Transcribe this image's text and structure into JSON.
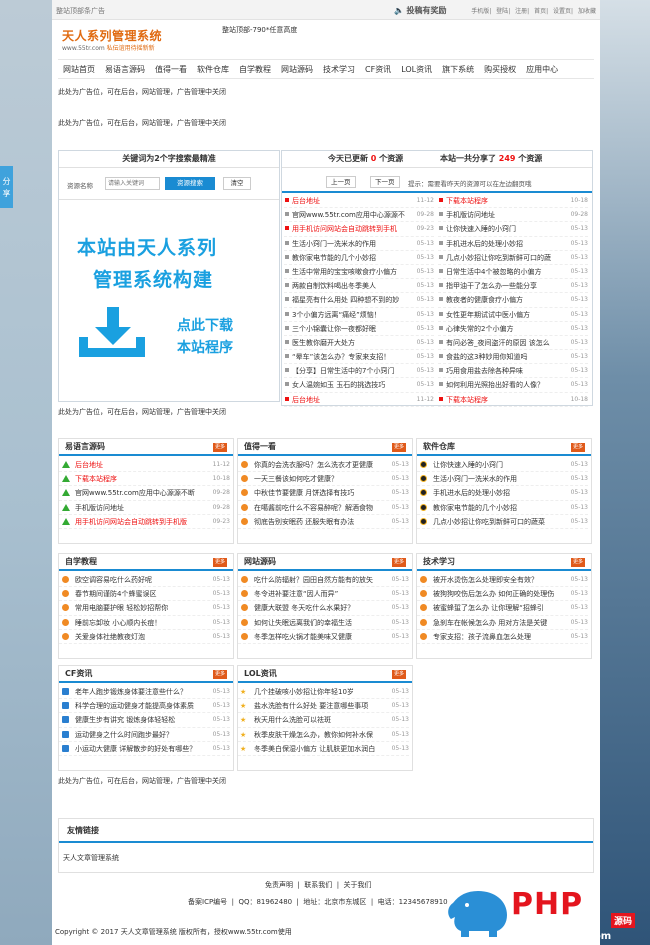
{
  "top": {
    "ad": "整站顶部条广告",
    "publish": "投稿有奖励",
    "links": [
      "手机版",
      "登陆",
      "注册",
      "首页",
      "设置页",
      "加收藏"
    ]
  },
  "logo": {
    "title": "天人系列管理系统",
    "url": "www.55tr.com",
    "slogan": "私伝谊用待摇新新"
  },
  "topad": "整站顶部-790*任意高度",
  "nav": [
    "网站首页",
    "易语言源码",
    "值得一看",
    "软件仓库",
    "自学教程",
    "网站源码",
    "技术学习",
    "CF资讯",
    "LOL资讯",
    "旗下系统",
    "购买授权",
    "应用中心"
  ],
  "ad_text": "此处为广告位，可在后台，网站管理，广告管理中关闭",
  "search": {
    "title": "关键词为2个字搜索最精准",
    "label": "资源名称",
    "placeholder": "请输入关键词",
    "search_btn": "资源搜索",
    "clear_btn": "清空"
  },
  "banner": {
    "line1": "本站由天人系列",
    "line2": "管理系统构建",
    "cta1": "点此下载",
    "cta2": "本站程序"
  },
  "today": {
    "prefix": "今天已更新",
    "count": "0",
    "suffix": "个资源"
  },
  "total": {
    "prefix": "本站一共分享了",
    "count": "249",
    "suffix": "个资源"
  },
  "pager": {
    "prev": "上一页",
    "next": "下一页",
    "hint": "提示：需要看昨天的资源可以在左边翻页哦"
  },
  "list_left": [
    {
      "t": "后台地址",
      "d": "11-12",
      "red": true
    },
    {
      "t": "官网www.55tr.com应用中心源源不",
      "d": "09-28"
    },
    {
      "t": "用手机访问网站会自动跳转到手机",
      "d": "09-23",
      "red": true
    },
    {
      "t": "生活小窍门一洗米水的作用",
      "d": "05-13"
    },
    {
      "t": "教你家电节能的几个小妙招",
      "d": "05-13"
    },
    {
      "t": "生活中常用的宝宝咳嗽食疗小偏方",
      "d": "05-13"
    },
    {
      "t": "两款自制饮料喝出冬季美人",
      "d": "05-13"
    },
    {
      "t": "福星亮有什么用处 四种想不到的妙",
      "d": "05-13"
    },
    {
      "t": "3个小偏方远离“痛经”烦恼！",
      "d": "05-13"
    },
    {
      "t": "三个小锦囊让你一夜都好眠",
      "d": "05-13"
    },
    {
      "t": "医生教你磨开大处方",
      "d": "05-13"
    },
    {
      "t": "“晕车”该怎么办？专家来支招！",
      "d": "05-13"
    },
    {
      "t": "【分享】日常生活中的7个小窍门",
      "d": "05-13"
    },
    {
      "t": "女人温婉如玉 玉石的挑选技巧",
      "d": "05-13"
    },
    {
      "t": "后台地址",
      "d": "11-12",
      "red": true
    }
  ],
  "list_right": [
    {
      "t": "下载本站程序",
      "d": "10-18",
      "red": true
    },
    {
      "t": "手机版访问地址",
      "d": "09-28"
    },
    {
      "t": "让你快速入睡的小窍门",
      "d": "05-13"
    },
    {
      "t": "手机进水后的处理小妙招",
      "d": "05-13"
    },
    {
      "t": "几点小妙招让你吃到新鲜可口的蔬",
      "d": "05-13"
    },
    {
      "t": "日常生活中4个被忽略的小偏方",
      "d": "05-13"
    },
    {
      "t": "指甲油干了怎么办一些能分享",
      "d": "05-13"
    },
    {
      "t": "教夜者的健康食疗小偏方",
      "d": "05-13"
    },
    {
      "t": "女性更年期试试中医小偏方",
      "d": "05-13"
    },
    {
      "t": "心律失常的2个小偏方",
      "d": "05-13"
    },
    {
      "t": "有问必答_夜间盗汗的原因 该怎么",
      "d": "05-13"
    },
    {
      "t": "食盐的这3种妙用你知道吗",
      "d": "05-13"
    },
    {
      "t": "巧用食用盐去除各种异味",
      "d": "05-13"
    },
    {
      "t": "如何利用光照抬出好看的人像？",
      "d": "05-13"
    },
    {
      "t": "下载本站程序",
      "d": "10-18",
      "red": true
    }
  ],
  "sections": [
    {
      "title": "易语言源码",
      "more": "更多",
      "icon": "triangle",
      "items": [
        {
          "t": "后台地址",
          "d": "11-12",
          "red": true
        },
        {
          "t": "下载本站程序",
          "d": "10-18",
          "red": true
        },
        {
          "t": "官网www.55tr.com应用中心源源不断",
          "d": "09-28"
        },
        {
          "t": "手机版访问地址",
          "d": "09-28"
        },
        {
          "t": "用手机访问网站会自动跳转到手机版",
          "d": "09-23",
          "red": true
        }
      ]
    },
    {
      "title": "值得一看",
      "more": "更多",
      "icon": "orange",
      "items": [
        {
          "t": "你真的会洗衣服吗？怎么洗衣才更健康",
          "d": "05-13"
        },
        {
          "t": "一天三餐该如何吃才健康？",
          "d": "05-13"
        },
        {
          "t": "中秋佳节要健康 月饼选择有技巧",
          "d": "05-13"
        },
        {
          "t": "在噶酱前吃什么不容易醉呢？解酒食物",
          "d": "05-13"
        },
        {
          "t": "彻底告别安眠药 还服失眠有办法",
          "d": "05-13"
        }
      ]
    },
    {
      "title": "软件仓库",
      "more": "更多",
      "icon": "penguin",
      "items": [
        {
          "t": "让你快速入睡的小窍门",
          "d": "05-13"
        },
        {
          "t": "生活小窍门一洗米水的作用",
          "d": "05-13"
        },
        {
          "t": "手机进水后的处理小妙招",
          "d": "05-13"
        },
        {
          "t": "教你家电节能的几个小妙招",
          "d": "05-13"
        },
        {
          "t": "几点小妙招让你吃到新鲜可口的蔬菜",
          "d": "05-13"
        }
      ]
    },
    {
      "title": "自学教程",
      "more": "更多",
      "icon": "orange",
      "items": [
        {
          "t": "欧空调容易吃什么药好呢",
          "d": "05-13"
        },
        {
          "t": "春节期间谨防4个蜂蜜误区",
          "d": "05-13"
        },
        {
          "t": "常用电脑要护眼 轻松妙招帮你",
          "d": "05-13"
        },
        {
          "t": "睡前忘卸妆 小心顺内长痘！",
          "d": "05-13"
        },
        {
          "t": "关爱身体社绝教夜灯泡",
          "d": "05-13"
        }
      ]
    },
    {
      "title": "网站源码",
      "more": "更多",
      "icon": "orange",
      "items": [
        {
          "t": "吃什么防辐射？园田自然方能有的放矢",
          "d": "05-13"
        },
        {
          "t": "冬令进补要注意“因人而异”",
          "d": "05-13"
        },
        {
          "t": "健康大联盟 冬天吃什么水果好？",
          "d": "05-13"
        },
        {
          "t": "如何让失眠远离我们的幸福生活",
          "d": "05-13"
        },
        {
          "t": "冬季怎样吃火锅才能美味又健康",
          "d": "05-13"
        }
      ]
    },
    {
      "title": "技术学习",
      "more": "更多",
      "icon": "orange",
      "items": [
        {
          "t": "被开水烫伤怎么处理即安全有效？",
          "d": "05-13"
        },
        {
          "t": "被狗狗咬伤后怎么办 如何正确的处理伤",
          "d": "05-13"
        },
        {
          "t": "被蜜蜂蜇了怎么办 让你理解“招蜂引",
          "d": "05-13"
        },
        {
          "t": "急刹车在帐候怎么办 用对方法是关键",
          "d": "05-13"
        },
        {
          "t": "专家支招：孩子流鼻血怎么处理",
          "d": "05-13"
        }
      ]
    },
    {
      "title": "CF资讯",
      "more": "更多",
      "icon": "blue",
      "items": [
        {
          "t": "老年人跑步锻炼身体要注意些什么？",
          "d": "05-13"
        },
        {
          "t": "科学合理的运动健身才能提高身体素质",
          "d": "05-13"
        },
        {
          "t": "健康生步有讲究 锻炼身体轻轻松",
          "d": "05-13"
        },
        {
          "t": "运动健身之什么时间跑步最好？",
          "d": "05-13"
        },
        {
          "t": "小运动大健康 详解散步的好处有哪些？",
          "d": "05-13"
        }
      ]
    },
    {
      "title": "LOL资讯",
      "more": "更多",
      "icon": "star",
      "items": [
        {
          "t": "几个挂破咳小妙招让你年轻10岁",
          "d": "05-13"
        },
        {
          "t": "盐水洗脸有什么好处 要注意哪些事项",
          "d": "05-13"
        },
        {
          "t": "秋天用什么洗脸可以祛斑",
          "d": "05-13"
        },
        {
          "t": "秋季皮肤干燥怎么办，教你如何补水保",
          "d": "05-13"
        },
        {
          "t": "冬季美白保湿小偏方 让肌肤更加水润白",
          "d": "05-13"
        }
      ]
    }
  ],
  "friend": {
    "title": "友情链接",
    "link": "天人文章管理系统"
  },
  "footer": {
    "links": [
      "免责声明",
      "联系我们",
      "关于我们"
    ],
    "icp": "备案ICP编号",
    "qq": "QQ：81962480",
    "addr": "地址：北京市东城区",
    "tel": "电话：12345678910",
    "copy": "Copyright © 2017 天人文章管理系统 版权所有，授权www.55tr.com使用"
  },
  "watermark": {
    "brand": "PHP",
    "sub": "源码",
    "url": "www.php333.com"
  },
  "sidetab": "分享"
}
